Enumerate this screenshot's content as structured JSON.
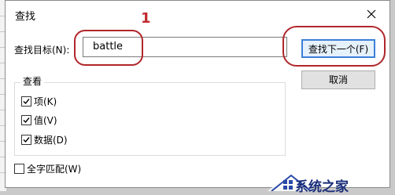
{
  "dialog": {
    "title": "查找"
  },
  "find": {
    "label": "查找目标(N):",
    "value": "battle"
  },
  "buttons": {
    "find_next": "查找下一个(F)",
    "cancel": "取消"
  },
  "look_in": {
    "title": "查看",
    "options": [
      {
        "label": "项(K)",
        "checked": true
      },
      {
        "label": "值(V)",
        "checked": true
      },
      {
        "label": "数据(D)",
        "checked": true
      }
    ]
  },
  "match_whole": {
    "label": "全字匹配(W)",
    "checked": false
  },
  "annotation": {
    "number": "1",
    "color": "#c0292d"
  },
  "watermark": {
    "text": "系统之家"
  }
}
